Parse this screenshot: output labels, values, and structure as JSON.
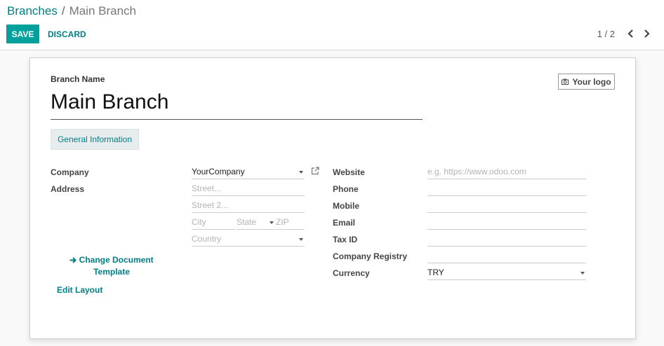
{
  "breadcrumb": {
    "parent": "Branches",
    "separator": "/",
    "current": "Main Branch"
  },
  "toolbar": {
    "save_label": "SAVE",
    "discard_label": "DISCARD"
  },
  "pager": {
    "value": "1 / 2"
  },
  "form": {
    "branch_name_label": "Branch Name",
    "branch_name_value": "Main Branch",
    "logo_button_label": "Your logo",
    "tab_label": "General Information",
    "company_label": "Company",
    "company_value": "YourCompany",
    "address_label": "Address",
    "street_placeholder": "Street...",
    "street2_placeholder": "Street 2...",
    "city_placeholder": "City",
    "state_placeholder": "State",
    "zip_placeholder": "ZIP",
    "country_placeholder": "Country",
    "change_doc_template_label": "Change Document Template",
    "edit_layout_label": "Edit Layout",
    "website_label": "Website",
    "website_placeholder": "e.g. https://www.odoo.com",
    "phone_label": "Phone",
    "mobile_label": "Mobile",
    "email_label": "Email",
    "tax_id_label": "Tax ID",
    "company_registry_label": "Company Registry",
    "currency_label": "Currency",
    "currency_value": "TRY"
  },
  "colors": {
    "primary": "#00a09d",
    "link": "#017e84"
  },
  "icons": {
    "arrow": "arrow-right-icon",
    "camera": "camera-icon",
    "external": "external-link-icon"
  }
}
